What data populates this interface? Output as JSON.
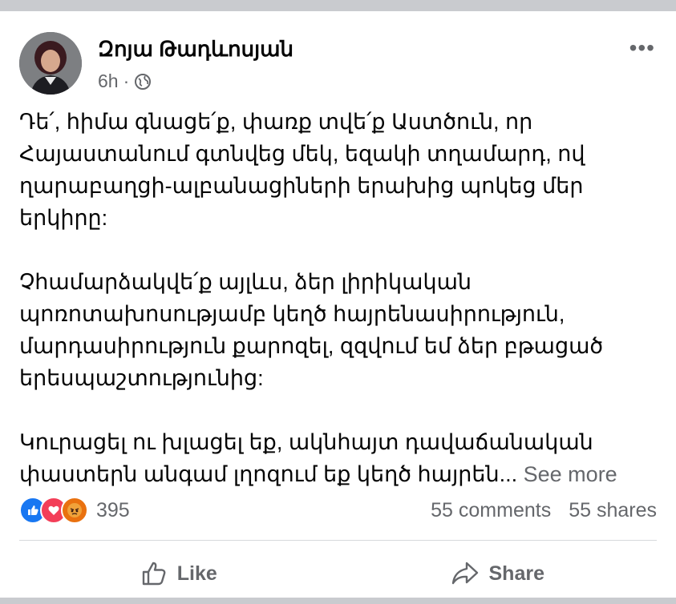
{
  "post": {
    "author": "Զոյա Թադևոսյան",
    "time": "6h",
    "separator": "·",
    "paragraphs": [
      "Դե՛, հիմա գնացե՛ք, փառք տվե՛ք Աստծուն, որ Հայաստանում գտնվեց մեկ, եզակի տղամարդ, ով ղարաբաղցի-ալբանացիների երախից պոկեց մեր երկիրը:",
      "Չհամարձակվե՛ք այլևս, ձեր լիրիկական պոռոտախոսությամբ կեղծ հայրենասիրություն, մարդասիրություն քարոզել, զզվում եմ ձեր բթացած երեսպաշտությունից:",
      "Կուրացել ու խլացել եք, ակնհայտ դավաճանական փաստերն անգամ լղոզում եք կեղծ հայրեն..."
    ],
    "see_more": "See more"
  },
  "stats": {
    "reaction_count": "395",
    "comments": "55 comments",
    "shares": "55 shares"
  },
  "actions": {
    "like": "Like",
    "share": "Share"
  },
  "colors": {
    "like_blue": "#1877f2",
    "love_red": "#f33e58",
    "angry_orange": "#e9710f",
    "secondary_text": "#65676b"
  }
}
